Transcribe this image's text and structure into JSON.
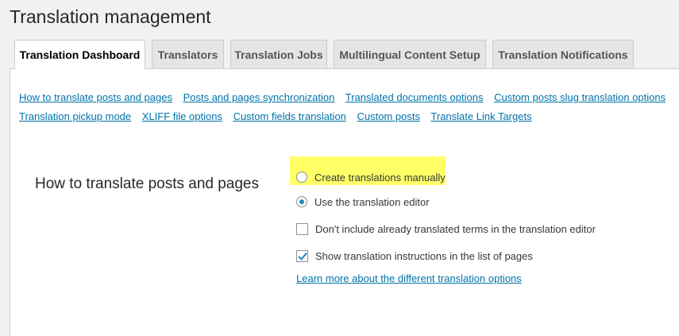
{
  "page": {
    "title": "Translation management"
  },
  "tabs": [
    {
      "label": "Translation Dashboard",
      "active": true
    },
    {
      "label": "Translators",
      "active": false
    },
    {
      "label": "Translation Jobs",
      "active": false
    },
    {
      "label": "Multilingual Content Setup",
      "active": false
    },
    {
      "label": "Translation Notifications",
      "active": false
    }
  ],
  "nav_links": [
    "How to translate posts and pages",
    "Posts and pages synchronization",
    "Translated documents options",
    "Custom posts slug translation options",
    "Translation pickup mode",
    "XLIFF file options",
    "Custom fields translation",
    "Custom posts",
    "Translate Link Targets"
  ],
  "section": {
    "title": "How to translate posts and pages",
    "radio_options": [
      {
        "label": "Create translations manually",
        "checked": false
      },
      {
        "label": "Use the translation editor",
        "checked": true
      }
    ],
    "checkbox_options": [
      {
        "label": "Don't include already translated terms in the translation editor",
        "checked": false
      },
      {
        "label": "Show translation instructions in the list of pages",
        "checked": true
      }
    ],
    "learn_more": "Learn more about the different translation options"
  },
  "colors": {
    "link": "#0073aa",
    "highlight": "#ffff66",
    "accent": "#1e8cbe"
  }
}
